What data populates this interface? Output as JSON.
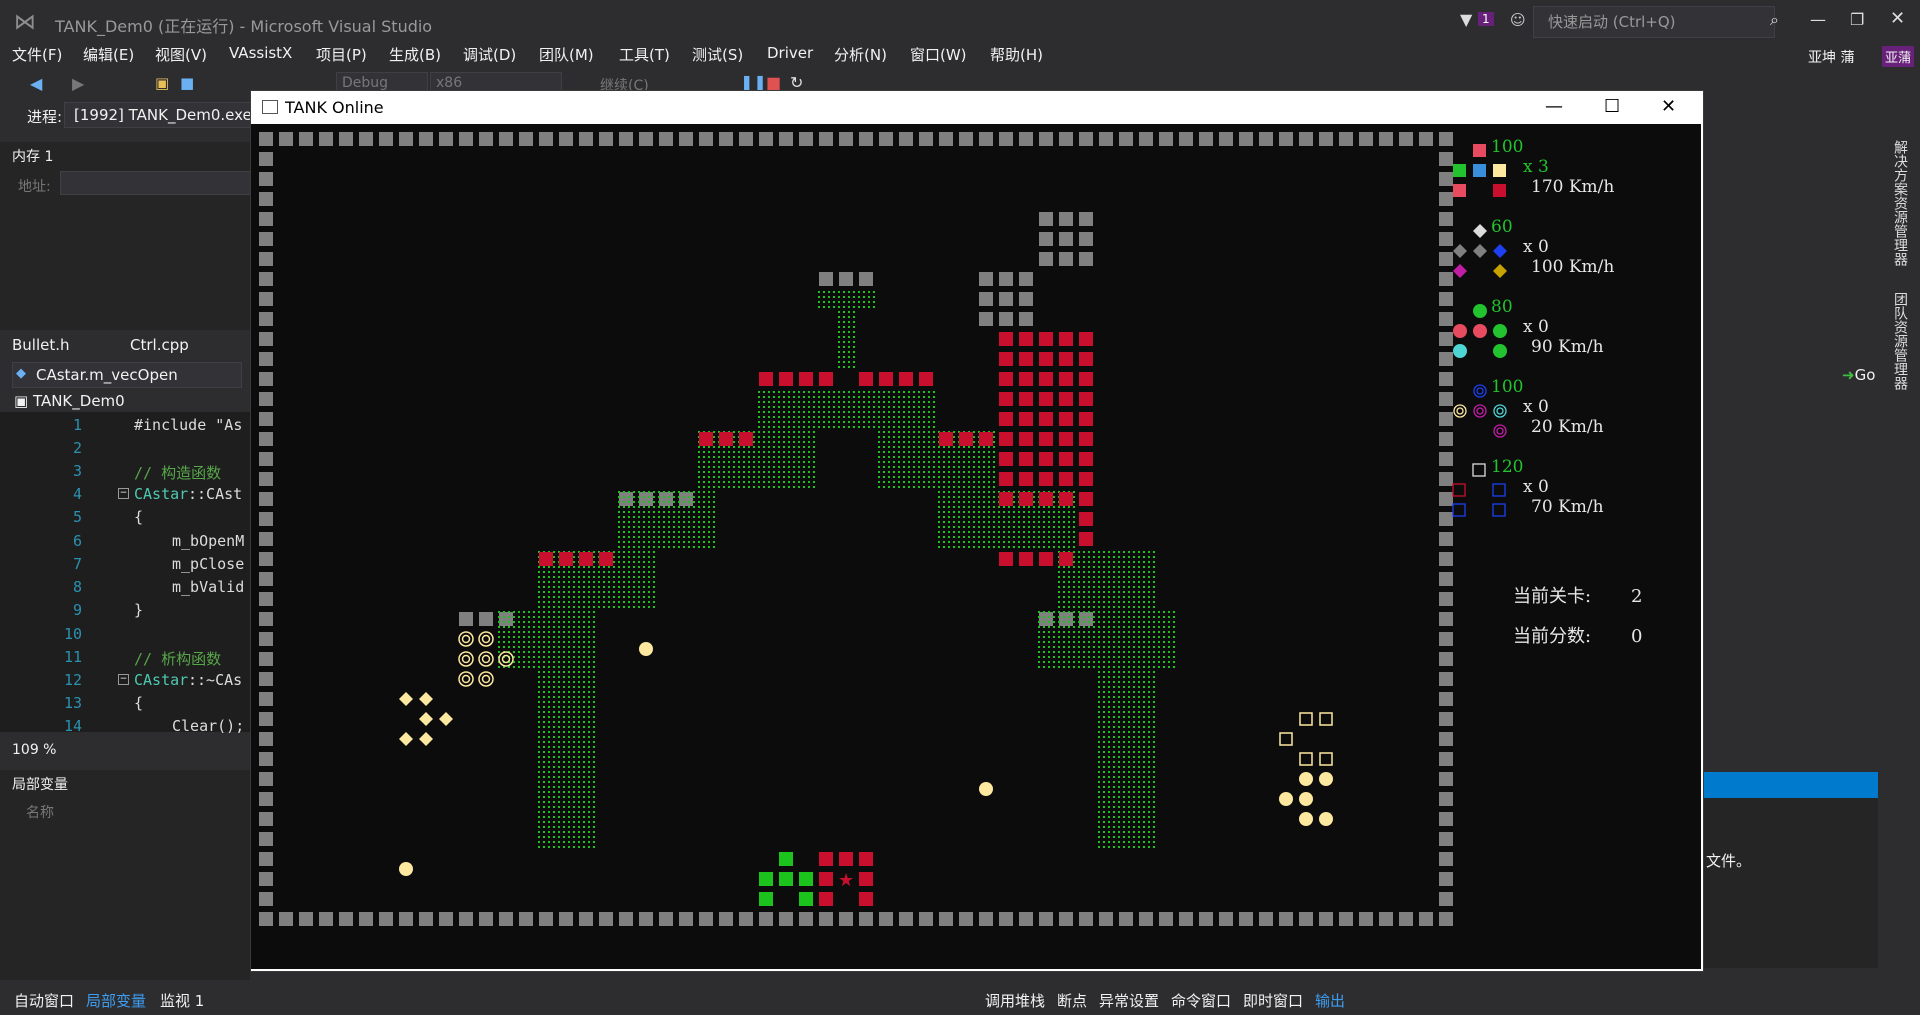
{
  "vs": {
    "title": "TANK_Dem0 (正在运行) - Microsoft Visual Studio",
    "quick_launch_placeholder": "快速启动 (Ctrl+Q)",
    "notification_count": "1",
    "user": "亚坤 蒲",
    "user_initials": "亚蒲",
    "menu": [
      "文件(F)",
      "编辑(E)",
      "视图(V)",
      "VAssistX",
      "项目(P)",
      "生成(B)",
      "调试(D)",
      "团队(M)",
      "工具(T)",
      "测试(S)",
      "Driver",
      "分析(N)",
      "窗口(W)",
      "帮助(H)"
    ],
    "toolbar": {
      "config": "Debug",
      "platform": "x86",
      "continue": "继续(C)"
    },
    "process_label": "进程:",
    "process_value": "[1992] TANK_Dem0.exe"
  },
  "memory_panel": {
    "title": "内存 1",
    "address_label": "地址:"
  },
  "doc_tabs": [
    "Bullet.h",
    "Ctrl.cpp"
  ],
  "nav_combo": "CAstar.m_vecOpen",
  "project": "TANK_Dem0",
  "editor": {
    "lines": [
      "1",
      "2",
      "3",
      "4",
      "5",
      "6",
      "7",
      "8",
      "9",
      "10",
      "11",
      "12",
      "13",
      "14"
    ],
    "code": {
      "l1": "#include \"As",
      "l3": "// 构造函数",
      "l4a": "CAstar",
      "l4b": "::CAst",
      "l5": "{",
      "l6": "m_bOpenM",
      "l7": "m_pClose",
      "l8": "m_bValid",
      "l9": "}",
      "l11": "// 析构函数",
      "l12a": "CAstar",
      "l12b": "::~CAs",
      "l13": "{",
      "l14": "Clear();"
    },
    "zoom": "109 %"
  },
  "locals_panel": {
    "title": "局部变量",
    "column": "名称"
  },
  "bottom_tabs_left": [
    "自动窗口",
    "局部变量",
    "监视 1"
  ],
  "bottom_tabs_right": [
    "调用堆栈",
    "断点",
    "异常设置",
    "命令窗口",
    "即时窗口",
    "输出"
  ],
  "right_side": {
    "solution_explorer": "解决方案资源管理器",
    "team_explorer": "团队资源管理器",
    "output_text": "文件。",
    "go": "Go"
  },
  "game": {
    "window_title": "TANK Online",
    "hud": [
      {
        "hp": "100",
        "count": "x 3",
        "speed": "170 Km/h",
        "color": "#22c32e"
      },
      {
        "hp": "60",
        "count": "x 0",
        "speed": "100 Km/h",
        "color": "#22c32e"
      },
      {
        "hp": "80",
        "count": "x 0",
        "speed": "90 Km/h",
        "color": "#22c32e"
      },
      {
        "hp": "100",
        "count": "x 0",
        "speed": "20 Km/h",
        "color": "#22c32e"
      },
      {
        "hp": "120",
        "count": "x 0",
        "speed": "70 Km/h",
        "color": "#22c32e"
      }
    ],
    "level_label": "当前关卡:",
    "level_value": "2",
    "score_label": "当前分数:",
    "score_value": "0",
    "colors": {
      "wall": "#808080",
      "brick": "#c8102e",
      "grass": "#1cc31c",
      "yellow": "#fde8a0",
      "player": "#1cc31c",
      "background": "#0c0c0c"
    }
  }
}
